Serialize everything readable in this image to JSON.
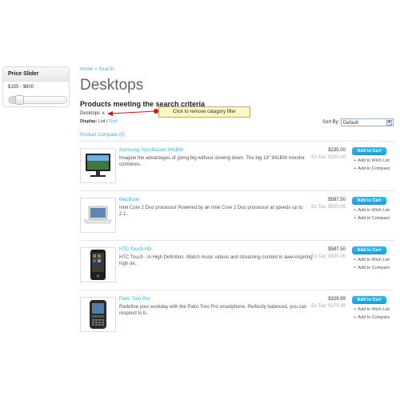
{
  "price_slider": {
    "title": "Price Slider",
    "range_text": "$155 - $800",
    "position_fraction": 0.15
  },
  "breadcrumb": [
    "Home",
    "Search"
  ],
  "page_title": "Desktops",
  "search_heading": "Products meeting the search criteria",
  "filter": {
    "label": "Desktops",
    "remove": "x"
  },
  "callout_text": "Click to remove catagory filter",
  "display": {
    "label": "Display:",
    "list": "List",
    "sep": "/",
    "grid": "Grid"
  },
  "sort": {
    "label": "Sort By:",
    "selected": "Default"
  },
  "product_compare": "Product Compare (0)",
  "add_to_cart_label": "Add to Cart",
  "wish_list_label": "Add to Wish List",
  "compare_label": "Add to Compare",
  "products": [
    {
      "name": "Samsung SyncMaster 941BW",
      "description": "Imagine the advantages of going big without slowing down. The big 19\" 941BW monitor combines..",
      "price": "$235.00",
      "ex_tax": "Ex Tax: $200.00",
      "image": "monitor"
    },
    {
      "name": "MacBook",
      "description": "Intel Core 2 Duo processor Powered by an Intel Core 2 Duo processor at speeds up to 2.1..",
      "price": "$587.50",
      "ex_tax": "Ex Tax: $500.00",
      "image": "laptop"
    },
    {
      "name": "HTC Touch HD",
      "description": "HTC Touch - in High Definition. Watch music videos and streaming content in awe-inspiring high de..",
      "price": "$587.50",
      "ex_tax": "Ex Tax: $500.00",
      "image": "phone-touch"
    },
    {
      "name": "Palm Treo Pro",
      "description": "Redefine your workday with the Palm Treo Pro smartphone. Perfectly balanced, you can respond to b..",
      "price": "$329.99",
      "ex_tax": "Ex Tax: $279.99",
      "image": "phone-keyboard"
    }
  ]
}
